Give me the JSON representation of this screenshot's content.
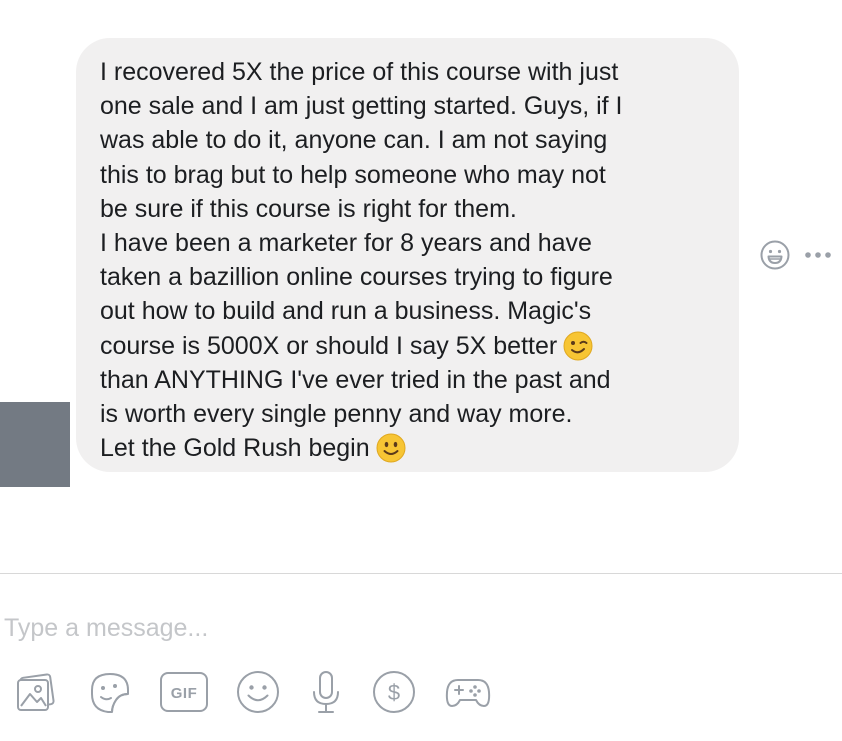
{
  "conversation": {
    "message": {
      "lines": [
        "I recovered 5X the price of this course with just",
        "one sale and I am just getting started. Guys, if I",
        "was able to do it, anyone can. I am not saying",
        "this to brag but to help someone who may not",
        "be sure if this course is right for them.",
        "I have been a marketer for 8 years and have",
        "taken a bazillion online courses trying to figure",
        "out how to build and run a business. Magic's",
        "course is 5000X or should I say 5X better",
        "than ANYTHING I've ever tried in the past and",
        "is worth every single penny and way more.",
        "Let the Gold Rush begin"
      ],
      "inline_emojis": [
        "winking-face",
        "smiling-face"
      ]
    },
    "side_actions": {
      "react_icon": "smiley-reaction-icon",
      "more_icon": "more-dots-icon"
    }
  },
  "composer": {
    "placeholder": "Type a message...",
    "toolbar": [
      {
        "icon": "photo-icon"
      },
      {
        "icon": "sticker-icon"
      },
      {
        "icon": "gif-icon",
        "label": "GIF"
      },
      {
        "icon": "emoji-icon"
      },
      {
        "icon": "microphone-icon"
      },
      {
        "icon": "payment-icon",
        "label": "$"
      },
      {
        "icon": "game-controller-icon"
      }
    ]
  },
  "colors": {
    "bubble_bg": "#f1f0f0",
    "text": "#1c1e21",
    "icon_gray": "#9aa0a8",
    "placeholder": "#c4c6c9",
    "avatar_placeholder": "#737a83",
    "emoji_yellow": "#f7c534"
  }
}
